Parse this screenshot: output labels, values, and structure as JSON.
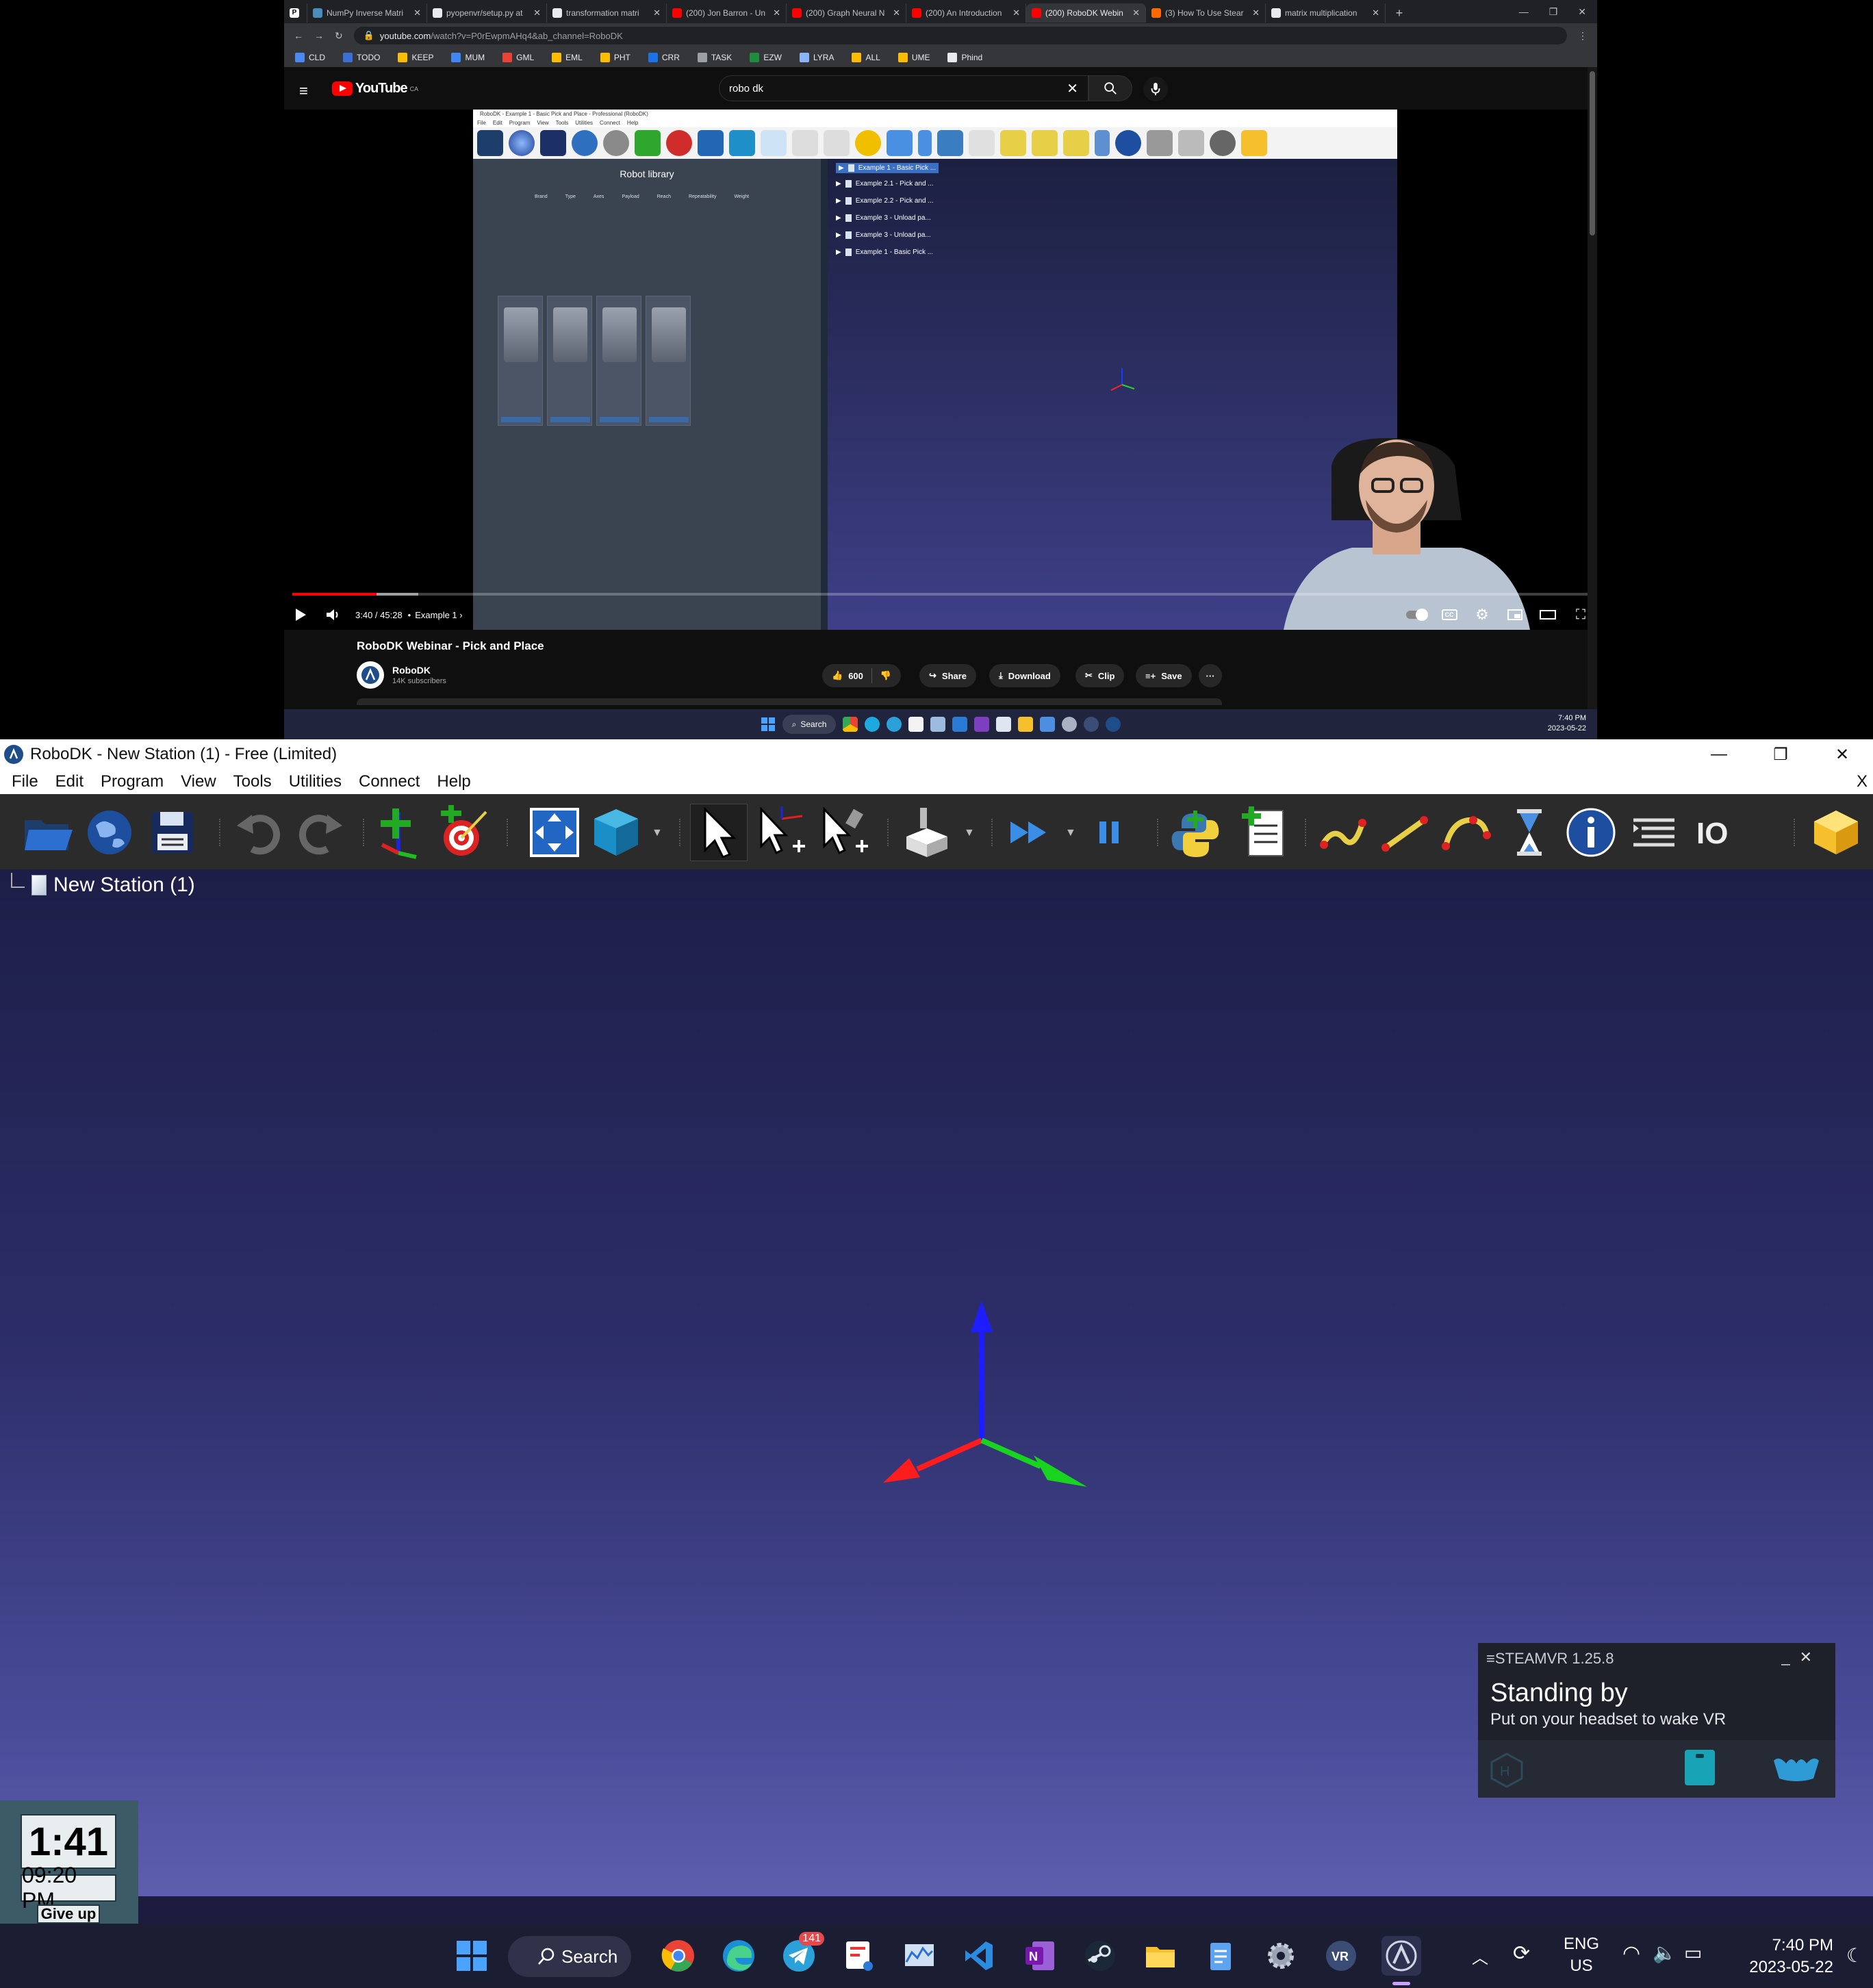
{
  "browser": {
    "tabs": [
      {
        "label": "NumPy Inverse Matri",
        "color": "#4b8bbe"
      },
      {
        "label": "pyopenvr/setup.py at",
        "color": "#e8eaed"
      },
      {
        "label": "transformation matri",
        "color": "#e8eaed"
      },
      {
        "label": "(200) Jon Barron - Un",
        "color": "#ff0000"
      },
      {
        "label": "(200) Graph Neural N",
        "color": "#ff0000"
      },
      {
        "label": "(200) An Introduction",
        "color": "#ff0000"
      },
      {
        "label": "(200) RoboDK Webin",
        "color": "#ff0000"
      },
      {
        "label": "(3) How To Use Stear",
        "color": "#ff6a00"
      },
      {
        "label": "matrix multiplication",
        "color": "#e8eaed"
      }
    ],
    "url_host": "youtube.com",
    "url_path": "/watch?v=P0rEwpmAHq4&ab_channel=RoboDK",
    "bookmarks": [
      {
        "label": "CLD",
        "color": "#4a8af4"
      },
      {
        "label": "TODO",
        "color": "#3b6fd6"
      },
      {
        "label": "KEEP",
        "color": "#fbbc04"
      },
      {
        "label": "MUM",
        "color": "#4285f4"
      },
      {
        "label": "GML",
        "color": "#ea4335"
      },
      {
        "label": "EML",
        "color": "#fbbc04"
      },
      {
        "label": "PHT",
        "color": "#fbbc04"
      },
      {
        "label": "CRR",
        "color": "#1a73e8"
      },
      {
        "label": "TASK",
        "color": "#9aa0a6"
      },
      {
        "label": "EZW",
        "color": "#1e8e3e"
      },
      {
        "label": "LYRA",
        "color": "#8ab4f8"
      },
      {
        "label": "ALL",
        "color": "#fbbc04"
      },
      {
        "label": "UME",
        "color": "#fbbc04"
      },
      {
        "label": "Phind",
        "color": "#e8eaed"
      }
    ]
  },
  "youtube": {
    "logo_text": "YouTube",
    "region": "CA",
    "search_value": "robo dk",
    "player": {
      "progress_fraction": 0.065,
      "time": "3:40 / 45:28",
      "chapter": "Example 1",
      "inner_app_title": "RoboDK - Example 1 - Basic Pick and Place - Professional (RoboDK)",
      "inner_menu": [
        "File",
        "Edit",
        "Program",
        "View",
        "Tools",
        "Utilities",
        "Connect",
        "Help"
      ],
      "library_title": "Robot library",
      "library_filters": [
        "Brand",
        "Type",
        "Axes",
        "Payload",
        "Reach",
        "Repeatability",
        "Weight"
      ],
      "tree_items": [
        "Example 1 - Basic Pick ...",
        "Example 2.1 - Pick and ...",
        "Example 2.2 - Pick and ...",
        "Example 3 - Unload pa...",
        "Example 3 - Unload pa...",
        "Example 1 - Basic Pick ..."
      ]
    },
    "video_title": "RoboDK Webinar - Pick and Place",
    "channel": "RoboDK",
    "subscribers": "14K subscribers",
    "likes": "600",
    "actions": [
      "Share",
      "Download",
      "Clip",
      "Save"
    ],
    "video_taskbar_search": "Search",
    "video_clock_time": "7:40 PM",
    "video_clock_date": "2023-05-22"
  },
  "robodk": {
    "title": "RoboDK - New Station (1) - Free (Limited)",
    "menu": [
      "File",
      "Edit",
      "Program",
      "View",
      "Tools",
      "Utilities",
      "Connect",
      "Help"
    ],
    "menu_close": "X",
    "station_name": "New Station (1)",
    "toolbar_icons": [
      "open-folder-icon",
      "online-library-icon",
      "save-icon",
      "undo-icon",
      "redo-icon",
      "add-reference-frame-icon",
      "add-target-icon",
      "fit-all-icon",
      "cube-view-icon",
      "select-icon",
      "move-reference-icon",
      "move-tool-icon",
      "tool-station-icon",
      "run-icon",
      "pause-icon",
      "python-icon",
      "add-program-icon",
      "joint-move-icon",
      "linear-move-icon",
      "circular-move-icon",
      "pause-instruction-icon",
      "message-icon",
      "program-call-icon",
      "io-icon",
      "add-on-icon"
    ]
  },
  "steamvr": {
    "header": "STEAMVR 1.25.8",
    "status": "Standing by",
    "message": "Put on your headset to wake VR"
  },
  "timer_widget": {
    "countdown": "1:41",
    "time": "09:20 PM",
    "button": "Give up"
  },
  "taskbar": {
    "search": "Search",
    "telegram_badge": "141",
    "lang_1": "ENG",
    "lang_2": "US",
    "time": "7:40 PM",
    "date": "2023-05-22"
  }
}
